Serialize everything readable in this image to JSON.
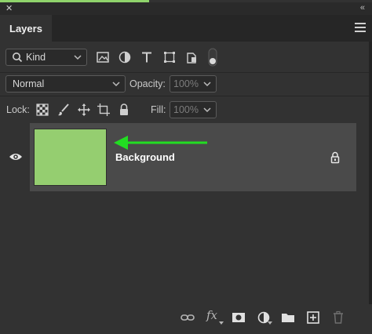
{
  "panel": {
    "close_symbol": "✕",
    "collapse_symbol": "«",
    "tab_label": "Layers",
    "menu_icon": "hamburger-menu-icon"
  },
  "filter": {
    "kind_label": "Kind",
    "icons": [
      "search-icon",
      "image-filter-icon",
      "adjustment-filter-icon",
      "type-filter-icon",
      "shape-filter-icon",
      "smart-object-filter-icon",
      "filter-toggle-icon"
    ]
  },
  "blend": {
    "mode": "Normal",
    "opacity_label": "Opacity:",
    "opacity_value": "100%"
  },
  "lock": {
    "label": "Lock:",
    "icons": [
      "lock-transparent-pixels-icon",
      "lock-image-pixels-icon",
      "lock-position-icon",
      "lock-artboard-icon",
      "lock-all-icon"
    ],
    "fill_label": "Fill:",
    "fill_value": "100%"
  },
  "layers": [
    {
      "name": "Background",
      "visible": true,
      "locked": true,
      "thumbnail_color": "#95ce70",
      "selected": true
    }
  ],
  "annotation": {
    "arrow_color": "#22dd22"
  },
  "bottom_icons": [
    "link-layers-icon",
    "fx-icon",
    "add-mask-icon",
    "new-adjustment-layer-icon",
    "new-group-icon",
    "new-layer-icon",
    "delete-layer-icon"
  ],
  "bottom_fx_text": "fx"
}
